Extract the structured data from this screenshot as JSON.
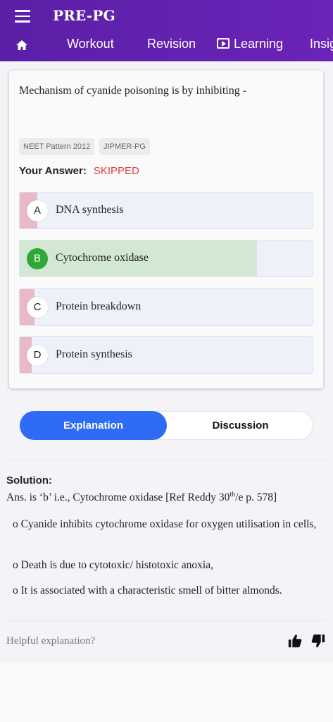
{
  "header": {
    "title": "PRE-PG",
    "tabs": [
      {
        "label": "Workout"
      },
      {
        "label": "Revision"
      },
      {
        "label": "Learning"
      },
      {
        "label": "Insig"
      }
    ]
  },
  "question": {
    "text": "Mechanism of cyanide poisoning is by inhibiting -",
    "tags": [
      "NEET Pattern 2012",
      "JIPMER-PG"
    ],
    "your_answer_label": "Your Answer:",
    "your_answer_value": "SKIPPED",
    "options": [
      {
        "letter": "A",
        "text": "DNA synthesis",
        "percent": 6,
        "color": "#e8b9c6"
      },
      {
        "letter": "B",
        "text": "Cytochrome oxidase",
        "percent": 81,
        "color": "#d2e8d4"
      },
      {
        "letter": "C",
        "text": "Protein breakdown",
        "percent": 5,
        "color": "#e8b9c6"
      },
      {
        "letter": "D",
        "text": "Protein synthesis",
        "percent": 4,
        "color": "#e8b9c6"
      }
    ]
  },
  "toggle": {
    "active": "Explanation",
    "inactive": "Discussion"
  },
  "solution": {
    "title": "Solution:",
    "answer_prefix": "Ans. is ‘b’ i.e., Cytochrome oxidase [Ref Reddy 30",
    "answer_sup": "th",
    "answer_suffix": "/e p. 578]",
    "bullets": [
      "o Cyanide inhibits cytochrome oxidase for oxygen utilisation in cells,",
      "o Death is due to cytotoxic/ histotoxic anoxia,",
      "o It is associated with a characteristic smell of bitter almonds."
    ]
  },
  "feedback": {
    "question": "Helpful explanation?"
  },
  "colors": {
    "header": "#5b1fa6",
    "accent": "#2e6cf6",
    "skipped": "#e03a45",
    "correct": "#2fa83a"
  }
}
